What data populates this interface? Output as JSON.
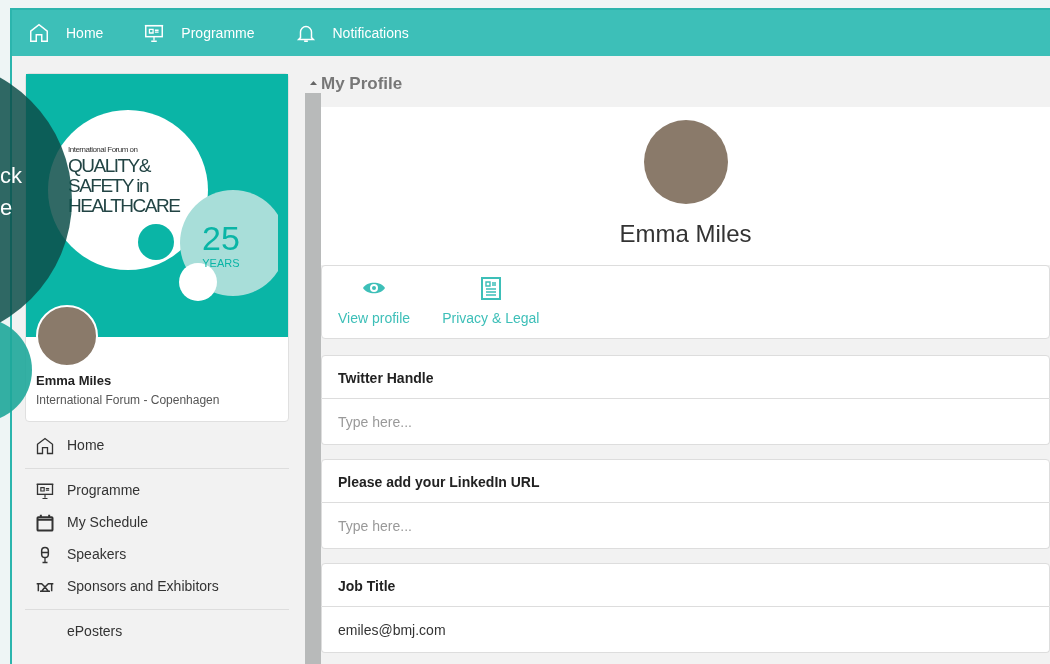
{
  "nav": [
    {
      "label": "Home"
    },
    {
      "label": "Programme"
    },
    {
      "label": "Notifications"
    }
  ],
  "overlay": {
    "fragments": [
      "ck",
      "e"
    ]
  },
  "profile_card": {
    "banner": {
      "small": "International Forum on",
      "title_lines": [
        "QUALITY&",
        "SAFETY in",
        "HEALTHCARE"
      ],
      "badge_number": "25",
      "badge_text": "YEARS"
    },
    "name": "Emma Miles",
    "subtitle": "International Forum - Copenhagen"
  },
  "sidebar": {
    "groups": [
      [
        {
          "label": "Home"
        }
      ],
      [
        {
          "label": "Programme"
        },
        {
          "label": "My Schedule"
        },
        {
          "label": "Speakers"
        },
        {
          "label": "Sponsors and Exhibitors"
        }
      ],
      [
        {
          "label": "ePosters"
        }
      ]
    ]
  },
  "main": {
    "title": "My Profile",
    "name": "Emma Miles",
    "actions": [
      {
        "label": "View profile"
      },
      {
        "label": "Privacy & Legal"
      }
    ],
    "fields": [
      {
        "label": "Twitter Handle",
        "placeholder": "Type here..."
      },
      {
        "label": "Please add your LinkedIn URL",
        "placeholder": "Type here..."
      },
      {
        "label": "Job Title",
        "value": "emiles@bmj.com"
      }
    ]
  }
}
